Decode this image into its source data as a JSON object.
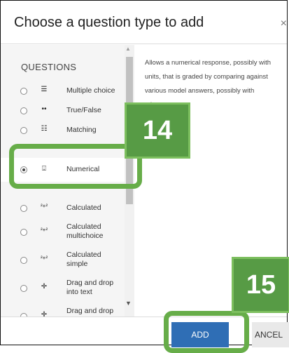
{
  "dialog": {
    "title": "Choose a question type to add",
    "close_symbol": "×"
  },
  "list": {
    "section_label": "QUESTIONS",
    "items": [
      {
        "label": "Multiple choice",
        "icon": "multiple-choice-icon",
        "glyph": "☰",
        "selected": false
      },
      {
        "label": "True/False",
        "icon": "true-false-icon",
        "glyph": "••",
        "selected": false
      },
      {
        "label": "Matching",
        "icon": "matching-icon",
        "glyph": "☷",
        "selected": false
      },
      {
        "label": "Numerical",
        "icon": "numerical-icon",
        "glyph": "⍗",
        "selected": true
      },
      {
        "label": "Calculated",
        "icon": "calculated-icon",
        "glyph": "²+²",
        "selected": false
      },
      {
        "label": "Calculated multichoice",
        "icon": "calculated-multichoice-icon",
        "glyph": "²+²",
        "selected": false
      },
      {
        "label": "Calculated simple",
        "icon": "calculated-simple-icon",
        "glyph": "²+²",
        "selected": false
      },
      {
        "label": "Drag and drop into text",
        "icon": "drag-drop-text-icon",
        "glyph": "✛",
        "selected": false
      },
      {
        "label": "Drag and drop",
        "icon": "drag-drop-icon",
        "glyph": "✛",
        "selected": false
      }
    ]
  },
  "description": "Allows a numerical response, possibly with units, that is graded by comparing against various model answers, possibly with tolerances.",
  "footer": {
    "add_label": "ADD",
    "cancel_label": "ANCEL"
  },
  "callouts": {
    "step_numerical": "14",
    "step_add": "15"
  },
  "colors": {
    "primary_button": "#2f6eb5",
    "callout_green": "#579b45",
    "highlight_green": "#67ad49"
  }
}
